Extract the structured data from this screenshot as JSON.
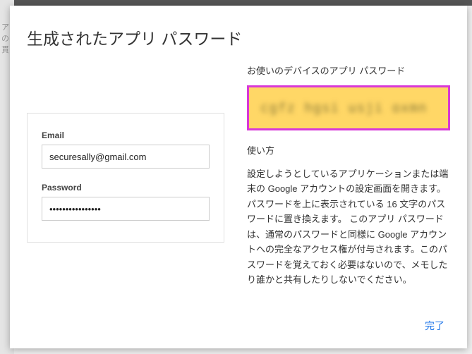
{
  "dialog": {
    "title": "生成されたアプリ パスワード"
  },
  "login": {
    "email_label": "Email",
    "email_value": "securesally@gmail.com",
    "password_label": "Password",
    "password_value": "••••••••••••••••"
  },
  "right": {
    "device_label": "お使いのデバイスのアプリ パスワード",
    "password_placeholder": "cgfz hgsi usji oxmn",
    "usage_title": "使い方",
    "usage_text": "設定しようとしているアプリケーションまたは端末の Google アカウントの設定画面を開きます。パスワードを上に表示されている 16 文字のパスワードに置き換えます。\nこのアプリ パスワードは、通常のパスワードと同様に Google アカウントへの完全なアクセス権が付与されます。このパスワードを覚えておく必要はないので、メモしたり誰かと共有したりしないでください。"
  },
  "actions": {
    "done": "完了"
  }
}
